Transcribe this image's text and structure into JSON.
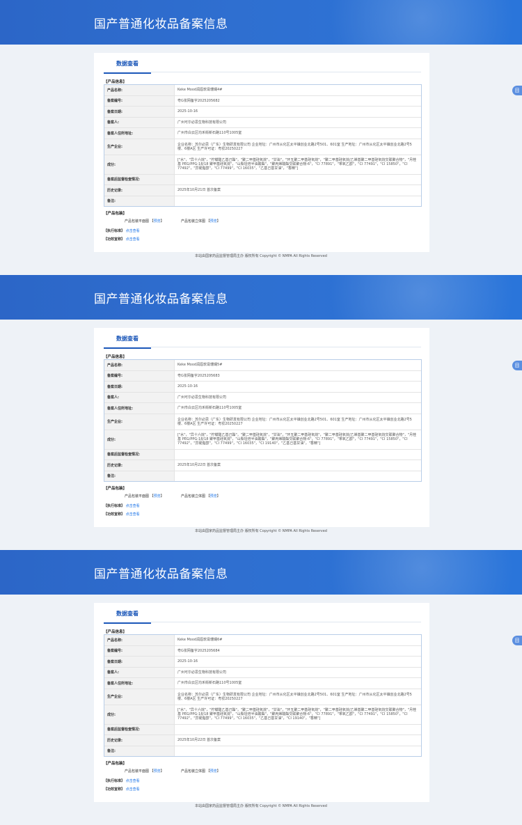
{
  "header": {
    "title": "国产普通化妆品备案信息"
  },
  "tab": {
    "label": "数据查看"
  },
  "sections": {
    "product_info": "【产品信息】",
    "package": "【产品包装】",
    "standard": "【执行标准】",
    "efficacy": "【功效宣称】"
  },
  "labels": {
    "name": "产品名称:",
    "number": "备案编号:",
    "date": "备案日期:",
    "registrant": "备案人:",
    "address": "备案人住所地址:",
    "producer": "生产企业:",
    "ingredients": "成分:",
    "post_check": "备案后监督检查情况:",
    "history": "历史记录:",
    "remark": "备注:"
  },
  "package": {
    "plan_label": "产品包装平面图",
    "solid_label": "产品包装立体图",
    "bracket_open": "【",
    "bracket_close": "】",
    "preview": "预览"
  },
  "click_to_view": "点击查看",
  "footer": "本站由国家药品监督管理局主办 版权所有 Copyright © NMPA All Rights Reserved",
  "float_icon": "目",
  "records": [
    {
      "name": "Keke Mood润唇软膏珊瑚4#",
      "number": "粤G妆网备字2025205682",
      "date": "2025-10-16",
      "registrant": "广州可尔必思生物科技有限公司",
      "address": "广州市白云区均禾街新石路110号1005室",
      "producer": "企业名称：苏尔必思（广东）生物研发有限公司 企业地址：广州市从化区太平镇创业北路2号501、601室 生产地址：广州市从化区太平镇创业北路2号5楼、6楼A区 生产许可证：粤妆20250227",
      "ingredients": "[\"水\"，\"异十六烷\"，\"柠檬酸乙基己酯\"，\"聚二甲基硅氧烷\"，\"甘油\"，\"环五聚二甲基硅氧烷\"，\"聚二甲基硅氧烷/乙烯基聚二甲基硅氧烷交联聚合物\"，\"月桂基 PEG/PPG-18/18 聚甲基硅氧烷\"，\"山梨坦倍半油酸酯\"，\"聚丙烯酸酯交联聚合物-6\"，\"CI 77891\"，\"苯氧乙醇\"，\"CI 77491\"，\"CI 15850\"，\"CI 77492\"，\"异硬脂醇\"，\"CI 77499\"，\"CI 16035\"，\"乙基己基甘油\"，\"香精\"]",
      "history": "2025年10月21日 首次备案"
    },
    {
      "name": "Keke Mood润唇软膏珊瑚5#",
      "number": "粤G妆网备字2025205683",
      "date": "2025-10-16",
      "registrant": "广州可尔必思生物科技有限公司",
      "address": "广州市白云区均禾街新石路110号1005室",
      "producer": "企业名称：苏尔必思（广东）生物研发有限公司 企业地址：广州市从化区太平镇创业北路2号501、601室 生产地址：广州市从化区太平镇创业北路2号5楼、6楼A区 生产许可证：粤妆20250227",
      "ingredients": "[\"水\"，\"异十六烷\"，\"柠檬酸乙基己酯\"，\"聚二甲基硅氧烷\"，\"甘油\"，\"环五聚二甲基硅氧烷\"，\"聚二甲基硅氧烷/乙烯基聚二甲基硅氧烷交联聚合物\"，\"月桂基 PEG/PPG-18/18 聚甲基硅氧烷\"，\"山梨坦倍半油酸酯\"，\"聚丙烯酸酯交联聚合物-6\"，\"CI 77891\"，\"苯氧乙醇\"，\"CI 77491\"，\"CI 15850\"，\"CI 77492\"，\"异硬脂醇\"，\"CI 77499\"，\"CI 16035\"，\"CI 19140\"，\"乙基己基甘油\"，\"香精\"]",
      "history": "2025年10月22日 首次备案"
    },
    {
      "name": "Keke Mood润唇软膏珊瑚6#",
      "number": "粤G妆网备字2025205684",
      "date": "2025-10-16",
      "registrant": "广州可尔必思生物科技有限公司",
      "address": "广州市白云区均禾街新石路110号1005室",
      "producer": "企业名称：苏尔必思（广东）生物研发有限公司 企业地址：广州市从化区太平镇创业北路2号501、601室 生产地址：广州市从化区太平镇创业北路2号5楼、6楼A区 生产许可证：粤妆20250227",
      "ingredients": "[\"水\"，\"异十六烷\"，\"柠檬酸乙基己酯\"，\"聚二甲基硅氧烷\"，\"甘油\"，\"环五聚二甲基硅氧烷\"，\"聚二甲基硅氧烷/乙烯基聚二甲基硅氧烷交联聚合物\"，\"月桂基 PEG/PPG-18/18 聚甲基硅氧烷\"，\"山梨坦倍半油酸酯\"，\"聚丙烯酸酯交联聚合物-6\"，\"CI 77891\"，\"苯氧乙醇\"，\"CI 77491\"，\"CI 15850\"，\"CI 77492\"，\"异硬脂醇\"，\"CI 77499\"，\"CI 16035\"，\"乙基己基甘油\"，\"CI 19140\"，\"香精\"]",
      "history": "2025年10月22日 首次备案"
    }
  ]
}
